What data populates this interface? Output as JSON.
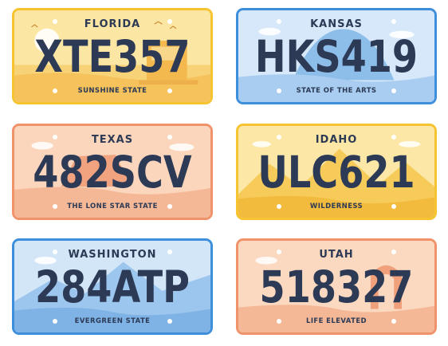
{
  "plates": [
    {
      "state": "FLORIDA",
      "number": "XTE357",
      "slogan": "SUNSHINE STATE",
      "border_color": "#f5c430",
      "bg_color": "#fbe08c",
      "accent_color": "#f6c86a"
    },
    {
      "state": "KANSAS",
      "number": "HKS419",
      "slogan": "STATE OF THE ARTS",
      "border_color": "#3d8fdc",
      "bg_color": "#cfe3f7",
      "accent_color": "#7fb3e6"
    },
    {
      "state": "TEXAS",
      "number": "482SCV",
      "slogan": "THE LONE STAR STATE",
      "border_color": "#f0936a",
      "bg_color": "#fbd2b6",
      "accent_color": "#f2a27c"
    },
    {
      "state": "IDAHO",
      "number": "ULC621",
      "slogan": "WILDERNESS",
      "border_color": "#f5c430",
      "bg_color": "#fbe08c",
      "accent_color": "#f3c046"
    },
    {
      "state": "WASHINGTON",
      "number": "284ATP",
      "slogan": "EVERGREEN STATE",
      "border_color": "#3d8fdc",
      "bg_color": "#cfe3f7",
      "accent_color": "#7fb3e6"
    },
    {
      "state": "UTAH",
      "number": "518327",
      "slogan": "LIFE ELEVATED",
      "border_color": "#f0936a",
      "bg_color": "#fbd2b6",
      "accent_color": "#f2a27c"
    }
  ]
}
